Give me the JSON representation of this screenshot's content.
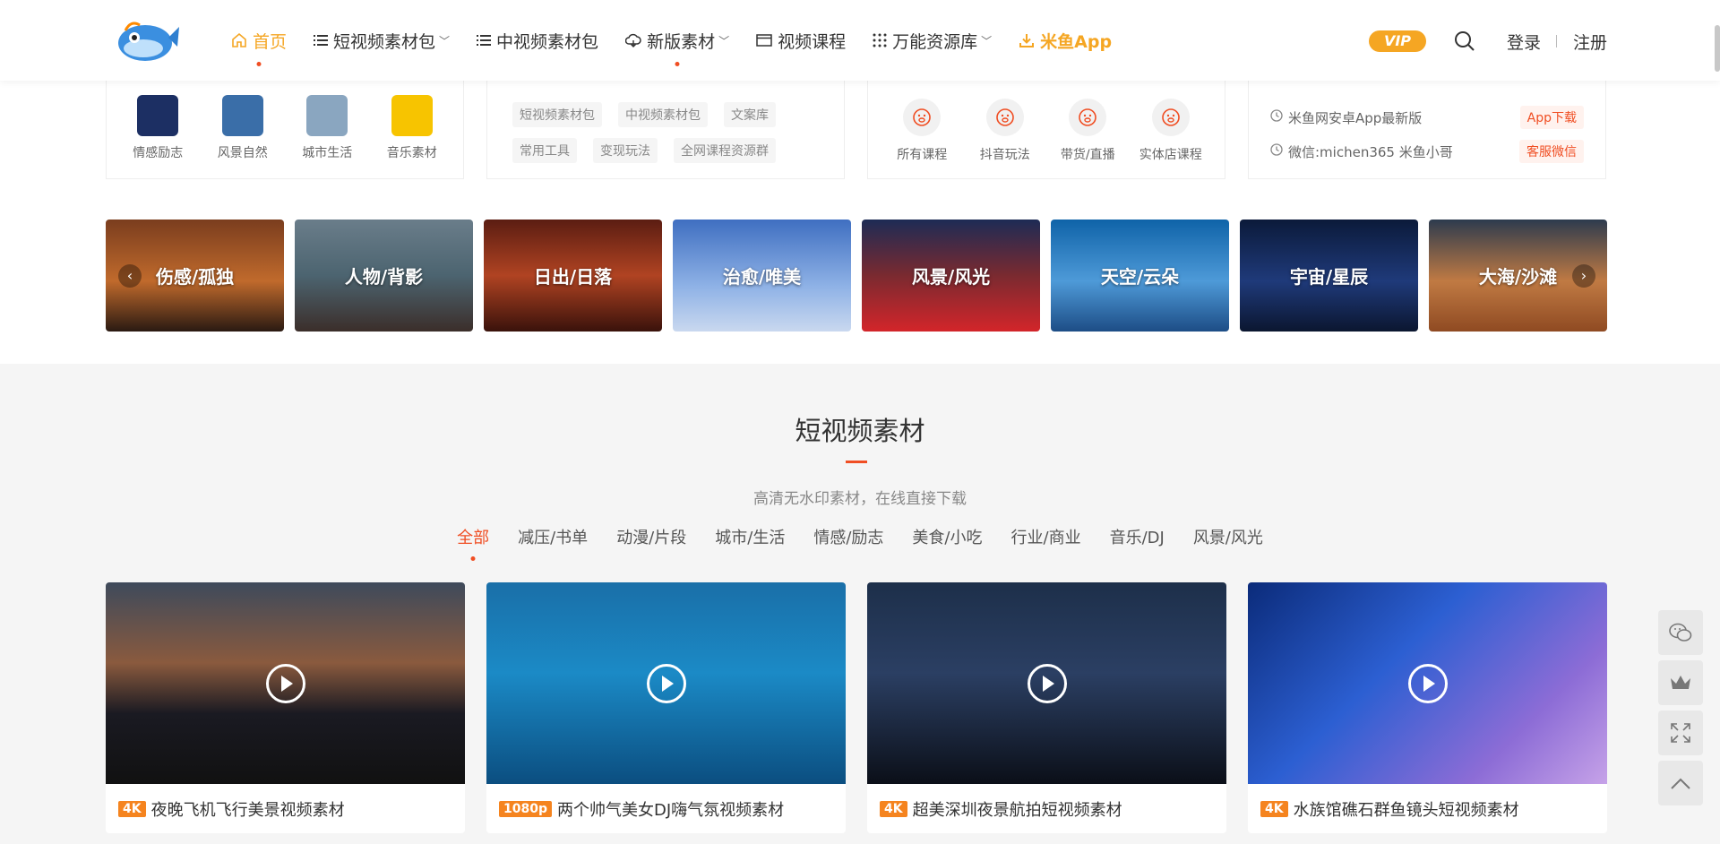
{
  "header": {
    "nav": [
      {
        "label": "首页",
        "icon": "home-icon",
        "active": true
      },
      {
        "label": "短视频素材包",
        "icon": "list-icon",
        "caret": true
      },
      {
        "label": "中视频素材包",
        "icon": "list-icon"
      },
      {
        "label": "新版素材",
        "icon": "cloud-icon",
        "caret": true
      },
      {
        "label": "视频课程",
        "icon": "window-icon"
      },
      {
        "label": "万能资源库",
        "icon": "grid-icon",
        "caret": true
      },
      {
        "label": "米鱼App",
        "icon": "download-icon"
      }
    ],
    "vip": "VIP",
    "login": "登录",
    "register": "注册"
  },
  "top_cards": {
    "categories": [
      {
        "label": "情感励志",
        "color": "#1c2f63"
      },
      {
        "label": "风景自然",
        "color": "#3a6ea8"
      },
      {
        "label": "城市生活",
        "color": "#8aa6c0"
      },
      {
        "label": "音乐素材",
        "color": "#f7c400"
      }
    ],
    "tags": [
      "短视频素材包",
      "中视频素材包",
      "文案库",
      "常用工具",
      "变现玩法",
      "全网课程资源群"
    ],
    "courses": [
      "所有课程",
      "抖音玩法",
      "带货/直播",
      "实体店课程"
    ],
    "info": [
      {
        "text": "米鱼网安卓App最新版",
        "button": "App下载"
      },
      {
        "text": "微信:michen365 米鱼小哥",
        "button": "客服微信"
      }
    ]
  },
  "slider": {
    "tiles": [
      {
        "label": "伤感/孤独",
        "bg": "linear-gradient(180deg,#7a3d1e 0%,#c06a2c 55%,#2a1a12 100%)"
      },
      {
        "label": "人物/背影",
        "bg": "linear-gradient(180deg,#6a7d8a 0%,#4c6470 50%,#3b2e2a 100%)"
      },
      {
        "label": "日出/日落",
        "bg": "linear-gradient(180deg,#5b1d12 0%,#b04322 50%,#3a120b 100%)"
      },
      {
        "label": "治愈/唯美",
        "bg": "linear-gradient(180deg,#3f6fc1 0%,#8fb2e6 60%,#c9d8ef 100%)"
      },
      {
        "label": "风景/风光",
        "bg": "linear-gradient(180deg,#1d2b55 0%,#7a2a30 50%,#d3252a 100%)"
      },
      {
        "label": "天空/云朵",
        "bg": "linear-gradient(180deg,#0f63a8 0%,#4e9ad8 55%,#1d4d86 100%)"
      },
      {
        "label": "宇宙/星辰",
        "bg": "linear-gradient(180deg,#0b1a3a 0%,#1f3a7a 55%,#0b1630 100%)"
      },
      {
        "label": "大海/沙滩",
        "bg": "linear-gradient(180deg,#2d3b4e 0%,#c07a43 55%,#8f4a22 100%)"
      }
    ]
  },
  "section": {
    "title": "短视频素材",
    "subtitle": "高清无水印素材，在线直接下载",
    "tabs": [
      "全部",
      "减压/书单",
      "动漫/片段",
      "城市/生活",
      "情感/励志",
      "美食/小吃",
      "行业/商业",
      "音乐/DJ",
      "风景/风光"
    ],
    "active_tab": 0
  },
  "videos": [
    {
      "res": "4K",
      "title": "夜晚飞机飞行美景视频素材",
      "bg": "linear-gradient(180deg,#3e4a5b 0%,#8a5a3e 40%,#1a1a22 65%,#111 100%)"
    },
    {
      "res": "1080p",
      "title": "两个帅气美女DJ嗨气氛视频素材",
      "bg": "linear-gradient(180deg,#1a6fa8 0%,#1b8ac6 45%,#0b4e80 100%)"
    },
    {
      "res": "4K",
      "title": "超美深圳夜景航拍短视频素材",
      "bg": "linear-gradient(180deg,#1d2f4a 0%,#2b3f63 45%,#0b0f18 100%)"
    },
    {
      "res": "4K",
      "title": "水族馆礁石群鱼镜头短视频素材",
      "bg": "linear-gradient(135deg,#0b2b7a 0%,#2c5fd2 40%,#8c6cd6 75%,#c6a2e8 100%)"
    }
  ],
  "side_tools": [
    "wechat-icon",
    "crown-icon",
    "expand-icon",
    "arrow-up-icon"
  ]
}
